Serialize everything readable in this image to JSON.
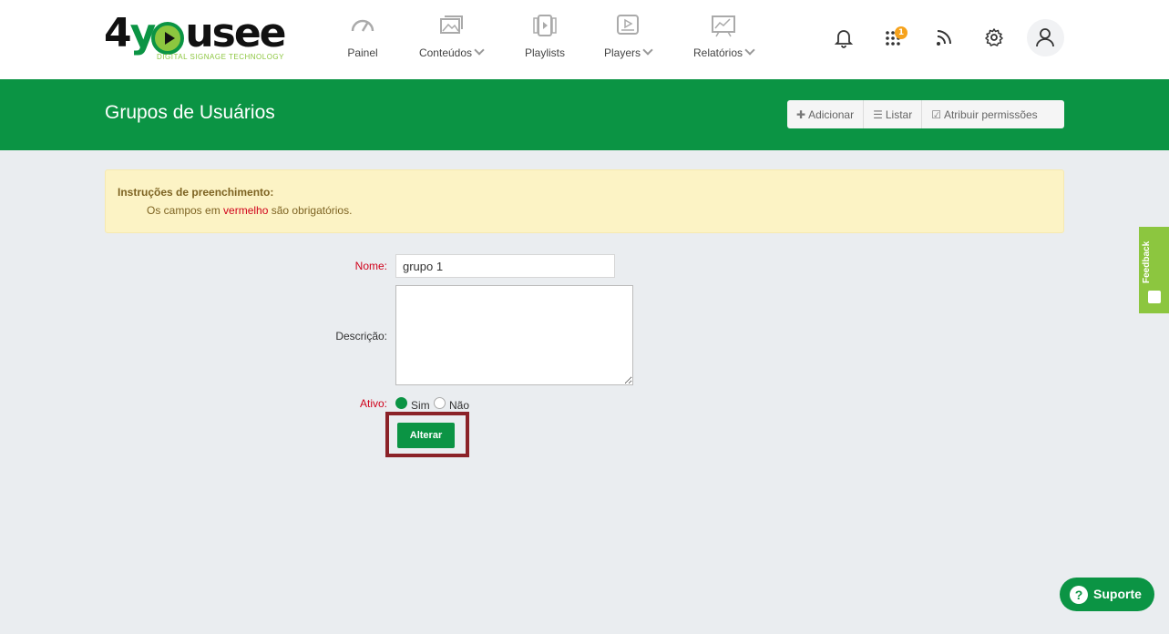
{
  "brand": {
    "logo_text_1": "4",
    "logo_text_2": "y",
    "logo_text_3": "usee",
    "tagline": "DIGITAL SIGNAGE TECHNOLOGY"
  },
  "nav": [
    {
      "label": "Painel",
      "icon": "gauge-icon"
    },
    {
      "label": "Conteúdos",
      "icon": "images-icon",
      "dropdown": true
    },
    {
      "label": "Playlists",
      "icon": "playlist-icon"
    },
    {
      "label": "Players",
      "icon": "player-icon",
      "dropdown": true
    },
    {
      "label": "Relatórios",
      "icon": "chart-icon",
      "dropdown": true
    }
  ],
  "top_icons": {
    "notifications": "bell-icon",
    "apps": "grid-dots-icon",
    "apps_badge": "1",
    "feed": "rss-icon",
    "settings": "gear-icon",
    "user": "user-icon"
  },
  "header": {
    "title": "Grupos de Usuários",
    "actions": [
      {
        "label": "Adicionar",
        "icon": "plus-icon"
      },
      {
        "label": "Listar",
        "icon": "list-icon"
      },
      {
        "label": "Atribuir permissões",
        "icon": "check-square-icon"
      }
    ]
  },
  "alert": {
    "title": "Instruções de preenchimento:",
    "text_before": "Os campos em ",
    "text_highlight": "vermelho",
    "text_after": " são obrigatórios."
  },
  "form": {
    "nome_label": "Nome:",
    "nome_value": "grupo 1",
    "descricao_label": "Descrição:",
    "descricao_value": "",
    "ativo_label": "Ativo:",
    "ativo_options": [
      "Sim",
      "Não"
    ],
    "ativo_selected": "Sim",
    "submit_label": "Alterar"
  },
  "feedback": {
    "label": "Feedback"
  },
  "support": {
    "label": "Suporte",
    "icon_glyph": "?"
  },
  "colors": {
    "primary_green": "#0b9444",
    "light_green": "#8cc63f",
    "badge_orange": "#f6a21b",
    "required_red": "#d0021b",
    "highlight_border": "#8b2228",
    "alert_bg": "#fcf3c5"
  }
}
